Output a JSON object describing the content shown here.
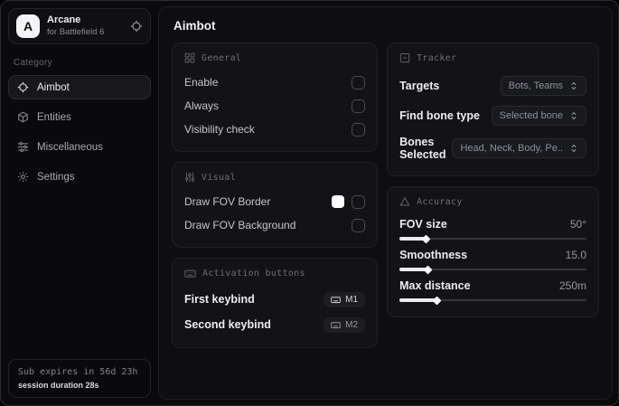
{
  "app": {
    "logo_letter": "A",
    "name": "Arcane",
    "subtitle": "for Battlefield 6"
  },
  "sidebar": {
    "category_label": "Category",
    "items": [
      {
        "label": "Aimbot",
        "icon": "crosshair-icon",
        "selected": true
      },
      {
        "label": "Entities",
        "icon": "cube-icon",
        "selected": false
      },
      {
        "label": "Miscellaneous",
        "icon": "sliders-icon",
        "selected": false
      },
      {
        "label": "Settings",
        "icon": "gear-icon",
        "selected": false
      }
    ],
    "footer": {
      "sub_expires": "Sub expires in 56d 23h",
      "session_duration": "session duration 28s"
    }
  },
  "main": {
    "title": "Aimbot",
    "general": {
      "header": "General",
      "rows": [
        {
          "label": "Enable",
          "checked": false
        },
        {
          "label": "Always",
          "checked": false
        },
        {
          "label": "Visibility check",
          "checked": false
        }
      ]
    },
    "visual": {
      "header": "Visual",
      "rows": [
        {
          "label": "Draw FOV Border",
          "swatch_color": "#ffffff",
          "checked": false
        },
        {
          "label": "Draw FOV Background",
          "checked": false
        }
      ]
    },
    "activation": {
      "header": "Activation buttons",
      "rows": [
        {
          "label": "First keybind",
          "key": "M1"
        },
        {
          "label": "Second keybind",
          "key": "M2"
        }
      ]
    },
    "tracker": {
      "header": "Tracker",
      "rows": [
        {
          "label": "Targets",
          "value": "Bots, Teams"
        },
        {
          "label": "Find bone type",
          "value": "Selected bone"
        },
        {
          "label": "Bones Selected",
          "value": "Head, Neck, Body, Pe.."
        }
      ]
    },
    "accuracy": {
      "header": "Accuracy",
      "sliders": [
        {
          "label": "FOV size",
          "value": "50°",
          "percent": 14
        },
        {
          "label": "Smoothness",
          "value": "15.0",
          "percent": 15
        },
        {
          "label": "Max distance",
          "value": "250m",
          "percent": 20
        }
      ]
    }
  },
  "colors": {
    "fov_border_swatch": "#ffffff",
    "accent": "#ffffff",
    "card_bg": "#131317",
    "panel_bg": "#0e0e11"
  }
}
